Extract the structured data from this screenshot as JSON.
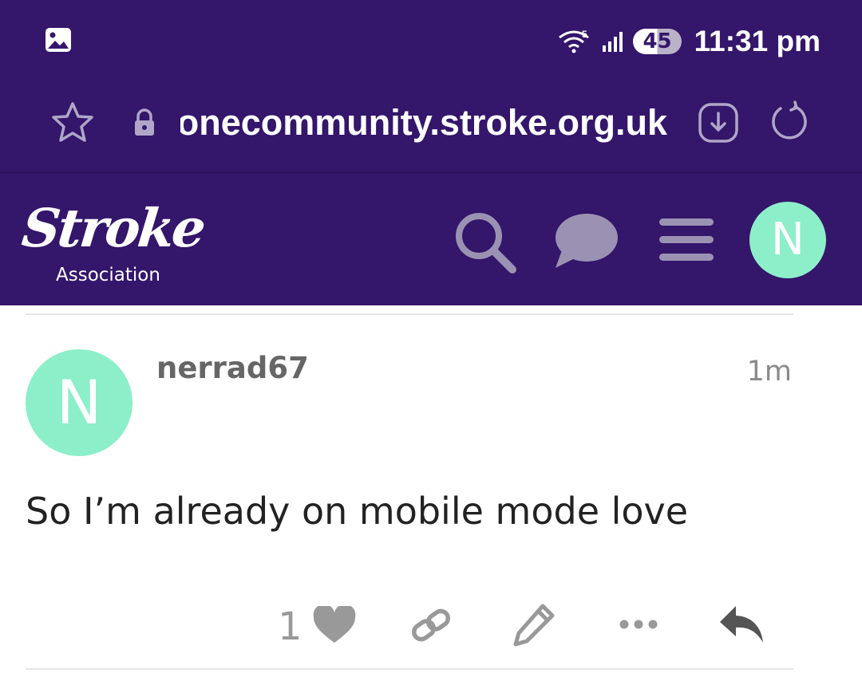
{
  "status_bar": {
    "battery": "45",
    "time": "11:31 pm",
    "icons": [
      "gallery-icon",
      "wifi-icon",
      "signal-icon"
    ]
  },
  "browser": {
    "url": "onecommunity.stroke.org.uk",
    "icons": [
      "star-icon",
      "lock-icon",
      "download-icon",
      "reload-icon"
    ]
  },
  "site_header": {
    "logo_word": "Stroke",
    "logo_sub": "Association",
    "avatar_letter": "N",
    "icons": [
      "search-icon",
      "chat-icon",
      "menu-icon"
    ],
    "colors": {
      "header_bg": "#34166b",
      "avatar_bg": "#8cefc9",
      "icon_color": "#9b92b3"
    }
  },
  "post": {
    "avatar_letter": "N",
    "username": "nerrad67",
    "time": "1m",
    "body": "So I’m already on mobile mode love",
    "like_count": "1",
    "actions": [
      "heart-icon",
      "link-icon",
      "pencil-icon",
      "more-icon",
      "reply-icon"
    ]
  }
}
